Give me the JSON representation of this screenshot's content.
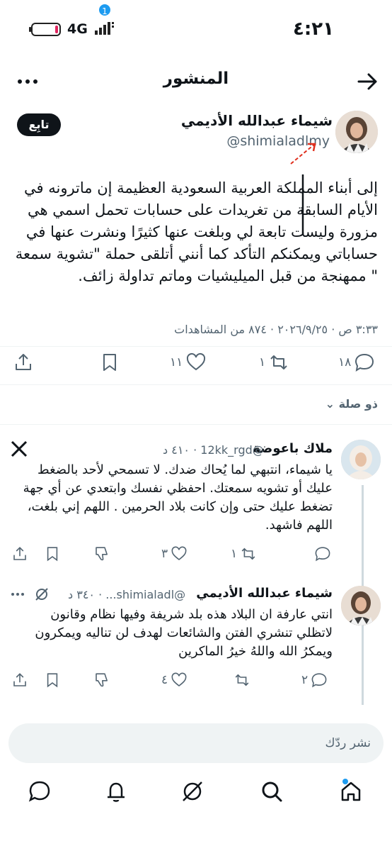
{
  "status_bar": {
    "time": "٤:٢١",
    "network": "4G",
    "battery_level": 0.12
  },
  "header": {
    "title": "المنشور"
  },
  "post": {
    "author_name": "شيماء عبدالله الأديمي",
    "author_handle": "@shimialadlmy",
    "follow_label": "تابِع",
    "text": "إلى أبناء المملكة العربية السعودية العظيمة إن ماترونه في الأيام السابقة من تغريدات على حسابات تحمل اسمي هي مزورة وليست تابعة لي وبلغت عنها كثيرًا ونشرت عنها في حساباتي ويمكنكم التأكد كما أنني أتلقى حملة \"تشوية سمعة \" ممهنجة من قبل الميليشيات وماتم تداولة زائف.",
    "meta": "٣:٣٣ ص · ٢٠٢٦/٩/٢٥ · ٨٧٤ من المشاهدات",
    "stats": {
      "replies": "١٨",
      "reposts": "١",
      "likes": "١١"
    }
  },
  "replies_filter": {
    "label": "ذو صلة"
  },
  "replies": [
    {
      "author_name": "ملاك باعوضة",
      "handle": "@12kk_rgd",
      "time": "٤١٠ د",
      "text": "يا شيماء، انتبهي لما يُحاك ضدك. لا تسمحي لأحد بالضغط عليك أو تشويه سمعتك. احفظي نفسك وابتعدي عن أي جهة تضغط عليك حتى وإن كانت بلاد الحرمين . اللهم إني بلغت، اللهم فاشهد.",
      "stats": {
        "replies": "",
        "reposts": "١",
        "likes": "٣"
      }
    },
    {
      "author_name": "شيماء عبدالله الأديمي",
      "handle": "@shimialadl...",
      "time": "٣٤٠ د",
      "text": "انتي عارفة ان البلاد هذه بلد شريفة وفيها نظام وقانون لاتظلي تنشري الفتن والشائعات لهدف لن تناليه ويمكرون ويمكرُ الله واللهُ خيرُ الماكرين",
      "stats": {
        "replies": "٢",
        "reposts": "",
        "likes": "٤"
      }
    }
  ],
  "composer": {
    "placeholder": "نشر ردّك"
  },
  "nav": {
    "notifications_badge": "1"
  },
  "colors": {
    "accent": "#1d9bf0",
    "text": "#0f1419",
    "muted": "#536471",
    "annotation": "#e0301e"
  }
}
